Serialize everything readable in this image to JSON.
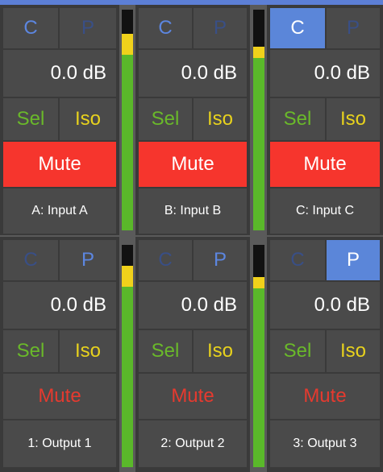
{
  "colors": {
    "background": "#5a5a5a",
    "cell": "#4a4a4a",
    "accent_blue": "#5b86d9",
    "sel_green": "#6ab92a",
    "iso_yellow": "#e8d21d",
    "mute_red": "#f6352d"
  },
  "rows": [
    {
      "channels": [
        {
          "c": "C",
          "p": "P",
          "gain": "0.0 dB",
          "sel": "Sel",
          "iso": "Iso",
          "mute": "Mute",
          "label": "A: Input A"
        },
        {
          "c": "C",
          "p": "P",
          "gain": "0.0 dB",
          "sel": "Sel",
          "iso": "Iso",
          "mute": "Mute",
          "label": "B: Input B"
        },
        {
          "c": "C",
          "p": "P",
          "gain": "0.0 dB",
          "sel": "Sel",
          "iso": "Iso",
          "mute": "Mute",
          "label": "C: Input C"
        }
      ]
    },
    {
      "channels": [
        {
          "c": "C",
          "p": "P",
          "gain": "0.0 dB",
          "sel": "Sel",
          "iso": "Iso",
          "mute": "Mute",
          "label": "1: Output 1"
        },
        {
          "c": "C",
          "p": "P",
          "gain": "0.0 dB",
          "sel": "Sel",
          "iso": "Iso",
          "mute": "Mute",
          "label": "2: Output 2"
        },
        {
          "c": "C",
          "p": "P",
          "gain": "0.0 dB",
          "sel": "Sel",
          "iso": "Iso",
          "mute": "Mute",
          "label": "3: Output 3"
        }
      ]
    }
  ]
}
